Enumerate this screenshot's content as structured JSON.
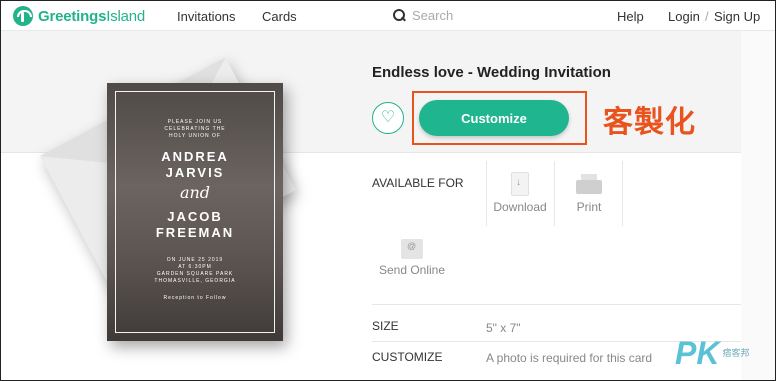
{
  "header": {
    "logo_bold": "Greetings",
    "logo_light": "Island",
    "nav": [
      "Invitations",
      "Cards"
    ],
    "search_placeholder": "Search",
    "help": "Help",
    "login": "Login",
    "separator": "/",
    "signup": "Sign Up"
  },
  "card": {
    "intro": [
      "PLEASE JOIN US",
      "CELEBRATING THE",
      "HOLY UNION OF"
    ],
    "name1_first": "ANDREA",
    "name1_last": "JARVIS",
    "and": "and",
    "name2_first": "JACOB",
    "name2_last": "FREEMAN",
    "details": [
      "ON JUNE 25 2019",
      "AT 6:30PM",
      "GARDEN SQUARE PARK",
      "THOMASVILLE, GEORGIA"
    ],
    "reception": "Reception to Follow"
  },
  "product": {
    "title": "Endless love - Wedding Invitation",
    "customize_label": "Customize",
    "annotation": "客製化",
    "available_for": "AVAILABLE FOR",
    "options": [
      "Download",
      "Print",
      "Send Online"
    ],
    "size_label": "SIZE",
    "size_value": "5\" x 7\"",
    "customize_row_label": "CUSTOMIZE",
    "customize_row_value": "A photo is required for this card"
  },
  "watermark": {
    "pk": "PK",
    "sub": "痞客邦"
  },
  "colors": {
    "brand": "#22b38a",
    "annotation": "#e8531e"
  }
}
